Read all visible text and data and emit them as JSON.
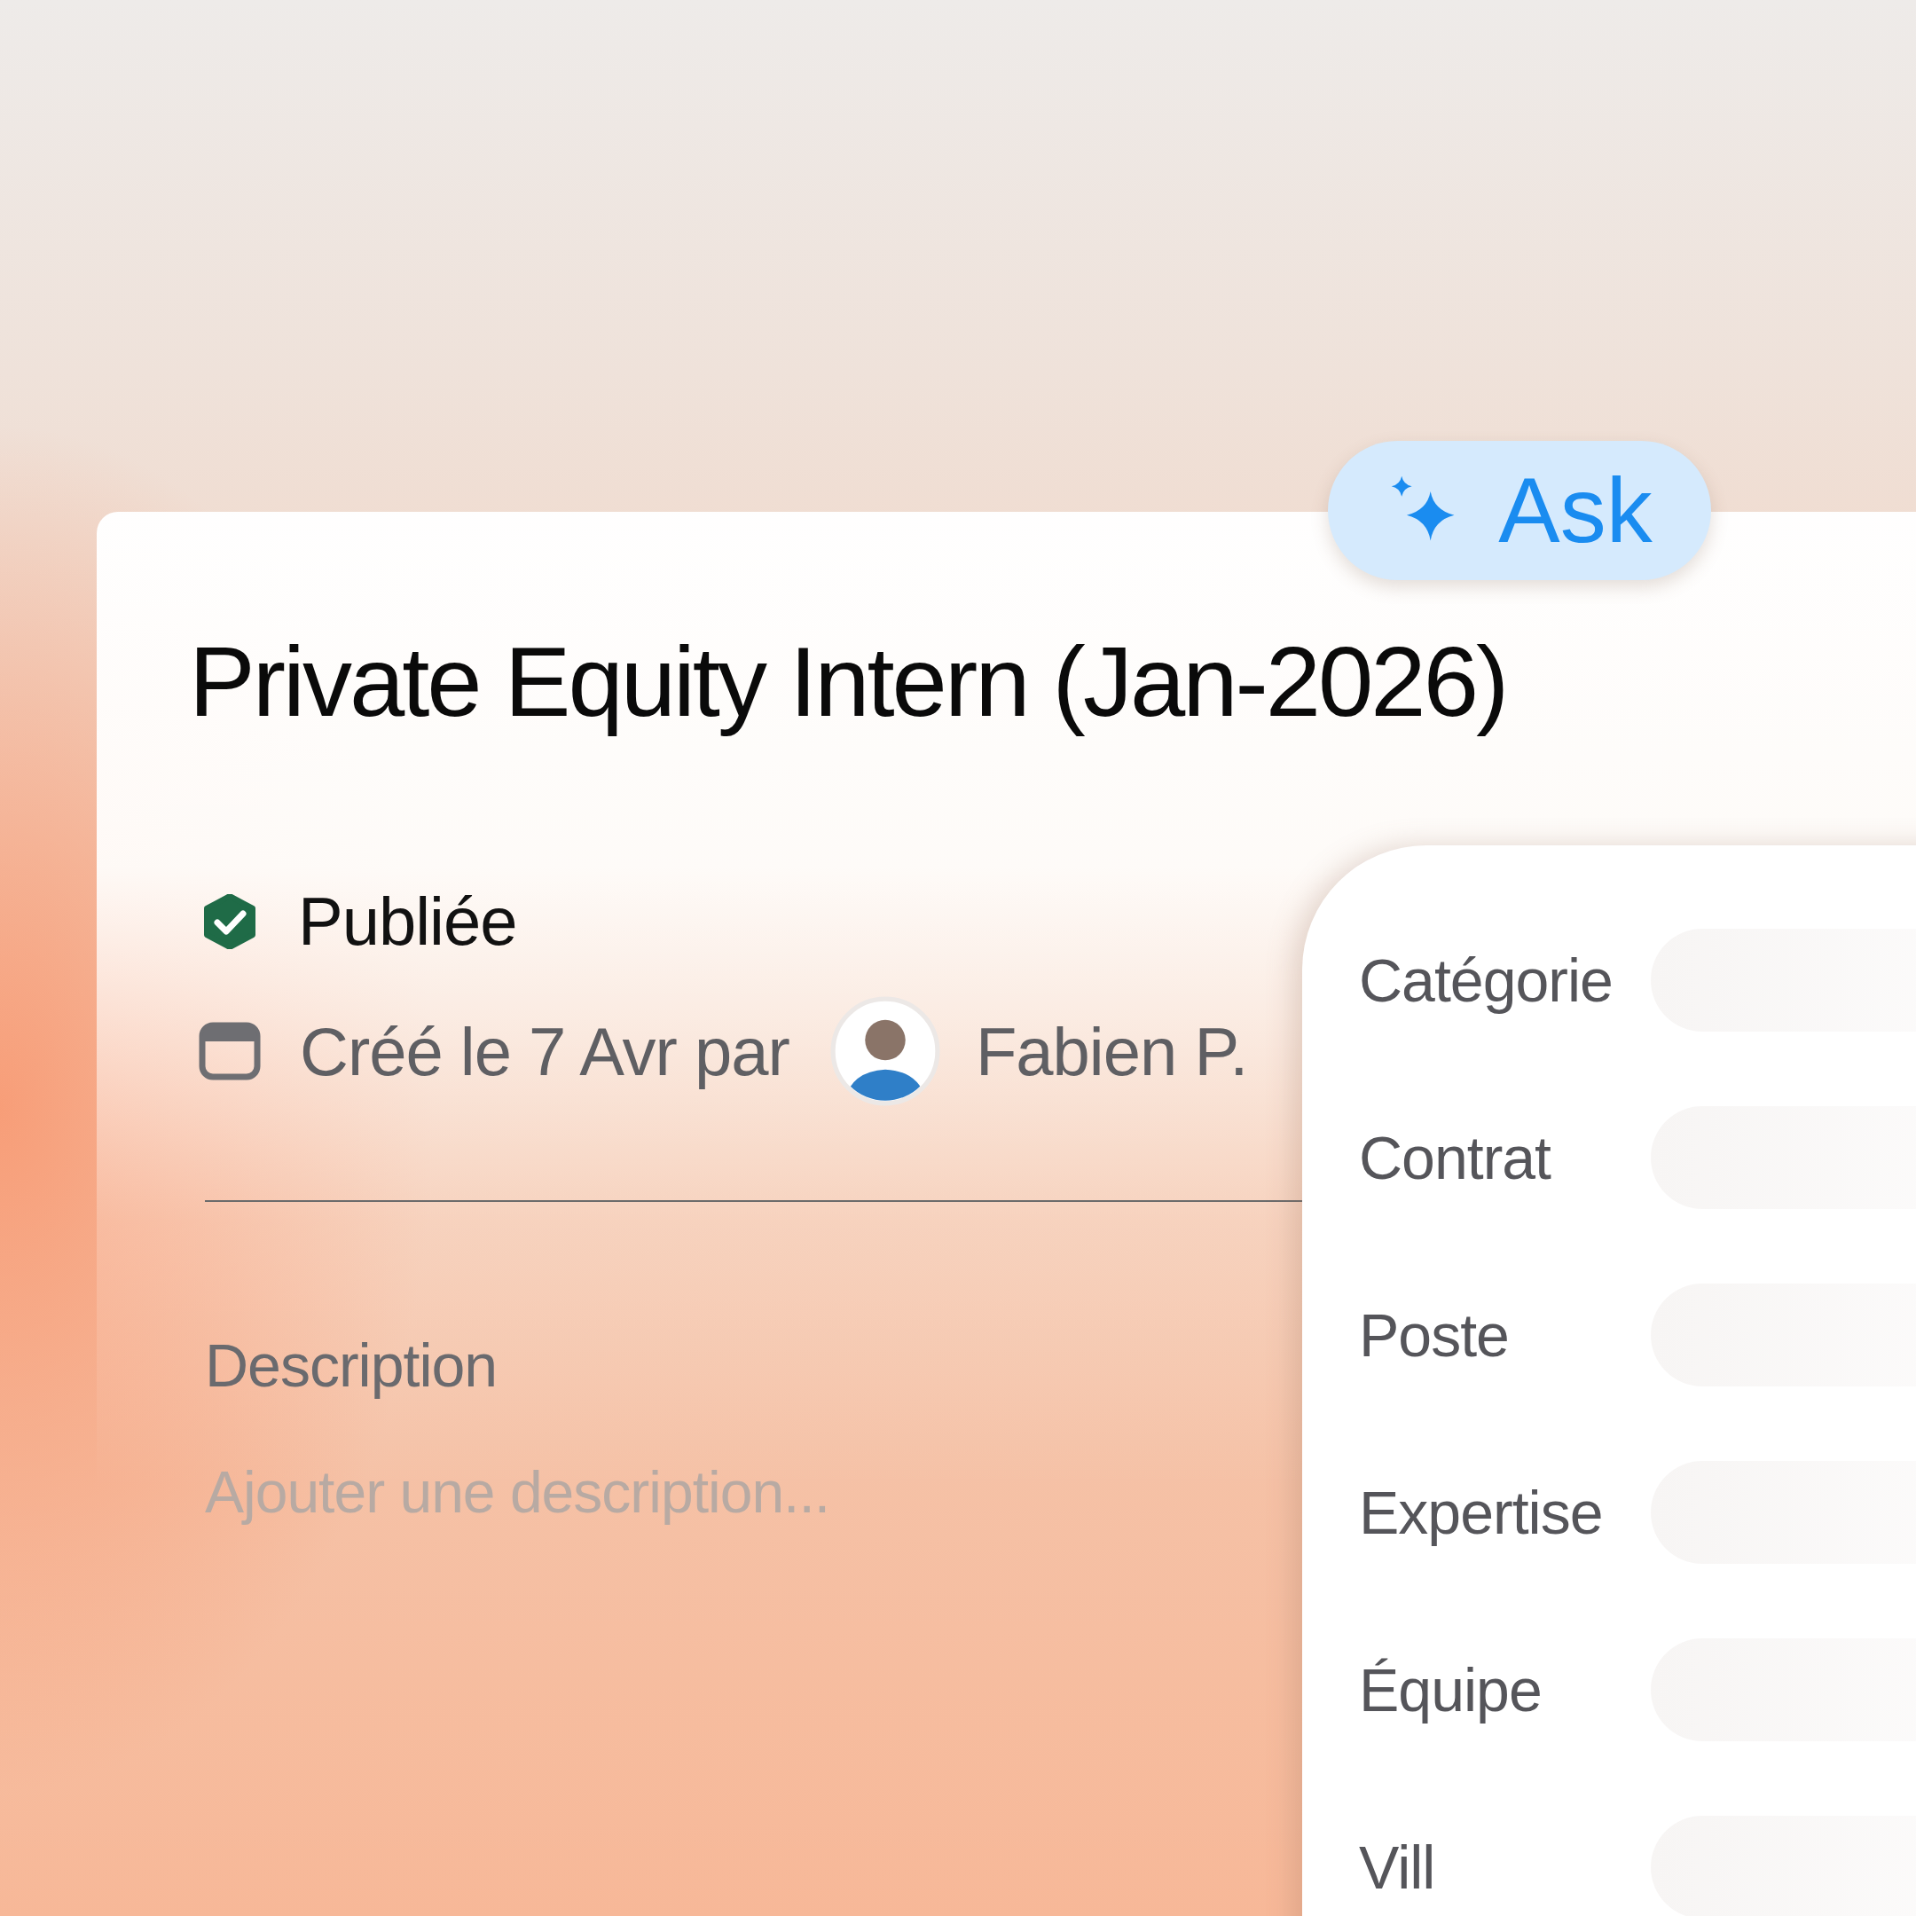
{
  "ask_button": {
    "label": "Ask"
  },
  "title": "Private Equity Intern (Jan-2026)",
  "status": {
    "label": "Publiée"
  },
  "created": {
    "text": "Créé le 7 Avr par",
    "author": "Fabien P."
  },
  "description": {
    "label": "Description",
    "placeholder": "Ajouter une description..."
  },
  "fields": [
    {
      "label": "Catégorie"
    },
    {
      "label": "Contrat"
    },
    {
      "label": "Poste"
    },
    {
      "label": "Expertise"
    },
    {
      "label": "Équipe"
    },
    {
      "label": "Vill"
    }
  ]
}
